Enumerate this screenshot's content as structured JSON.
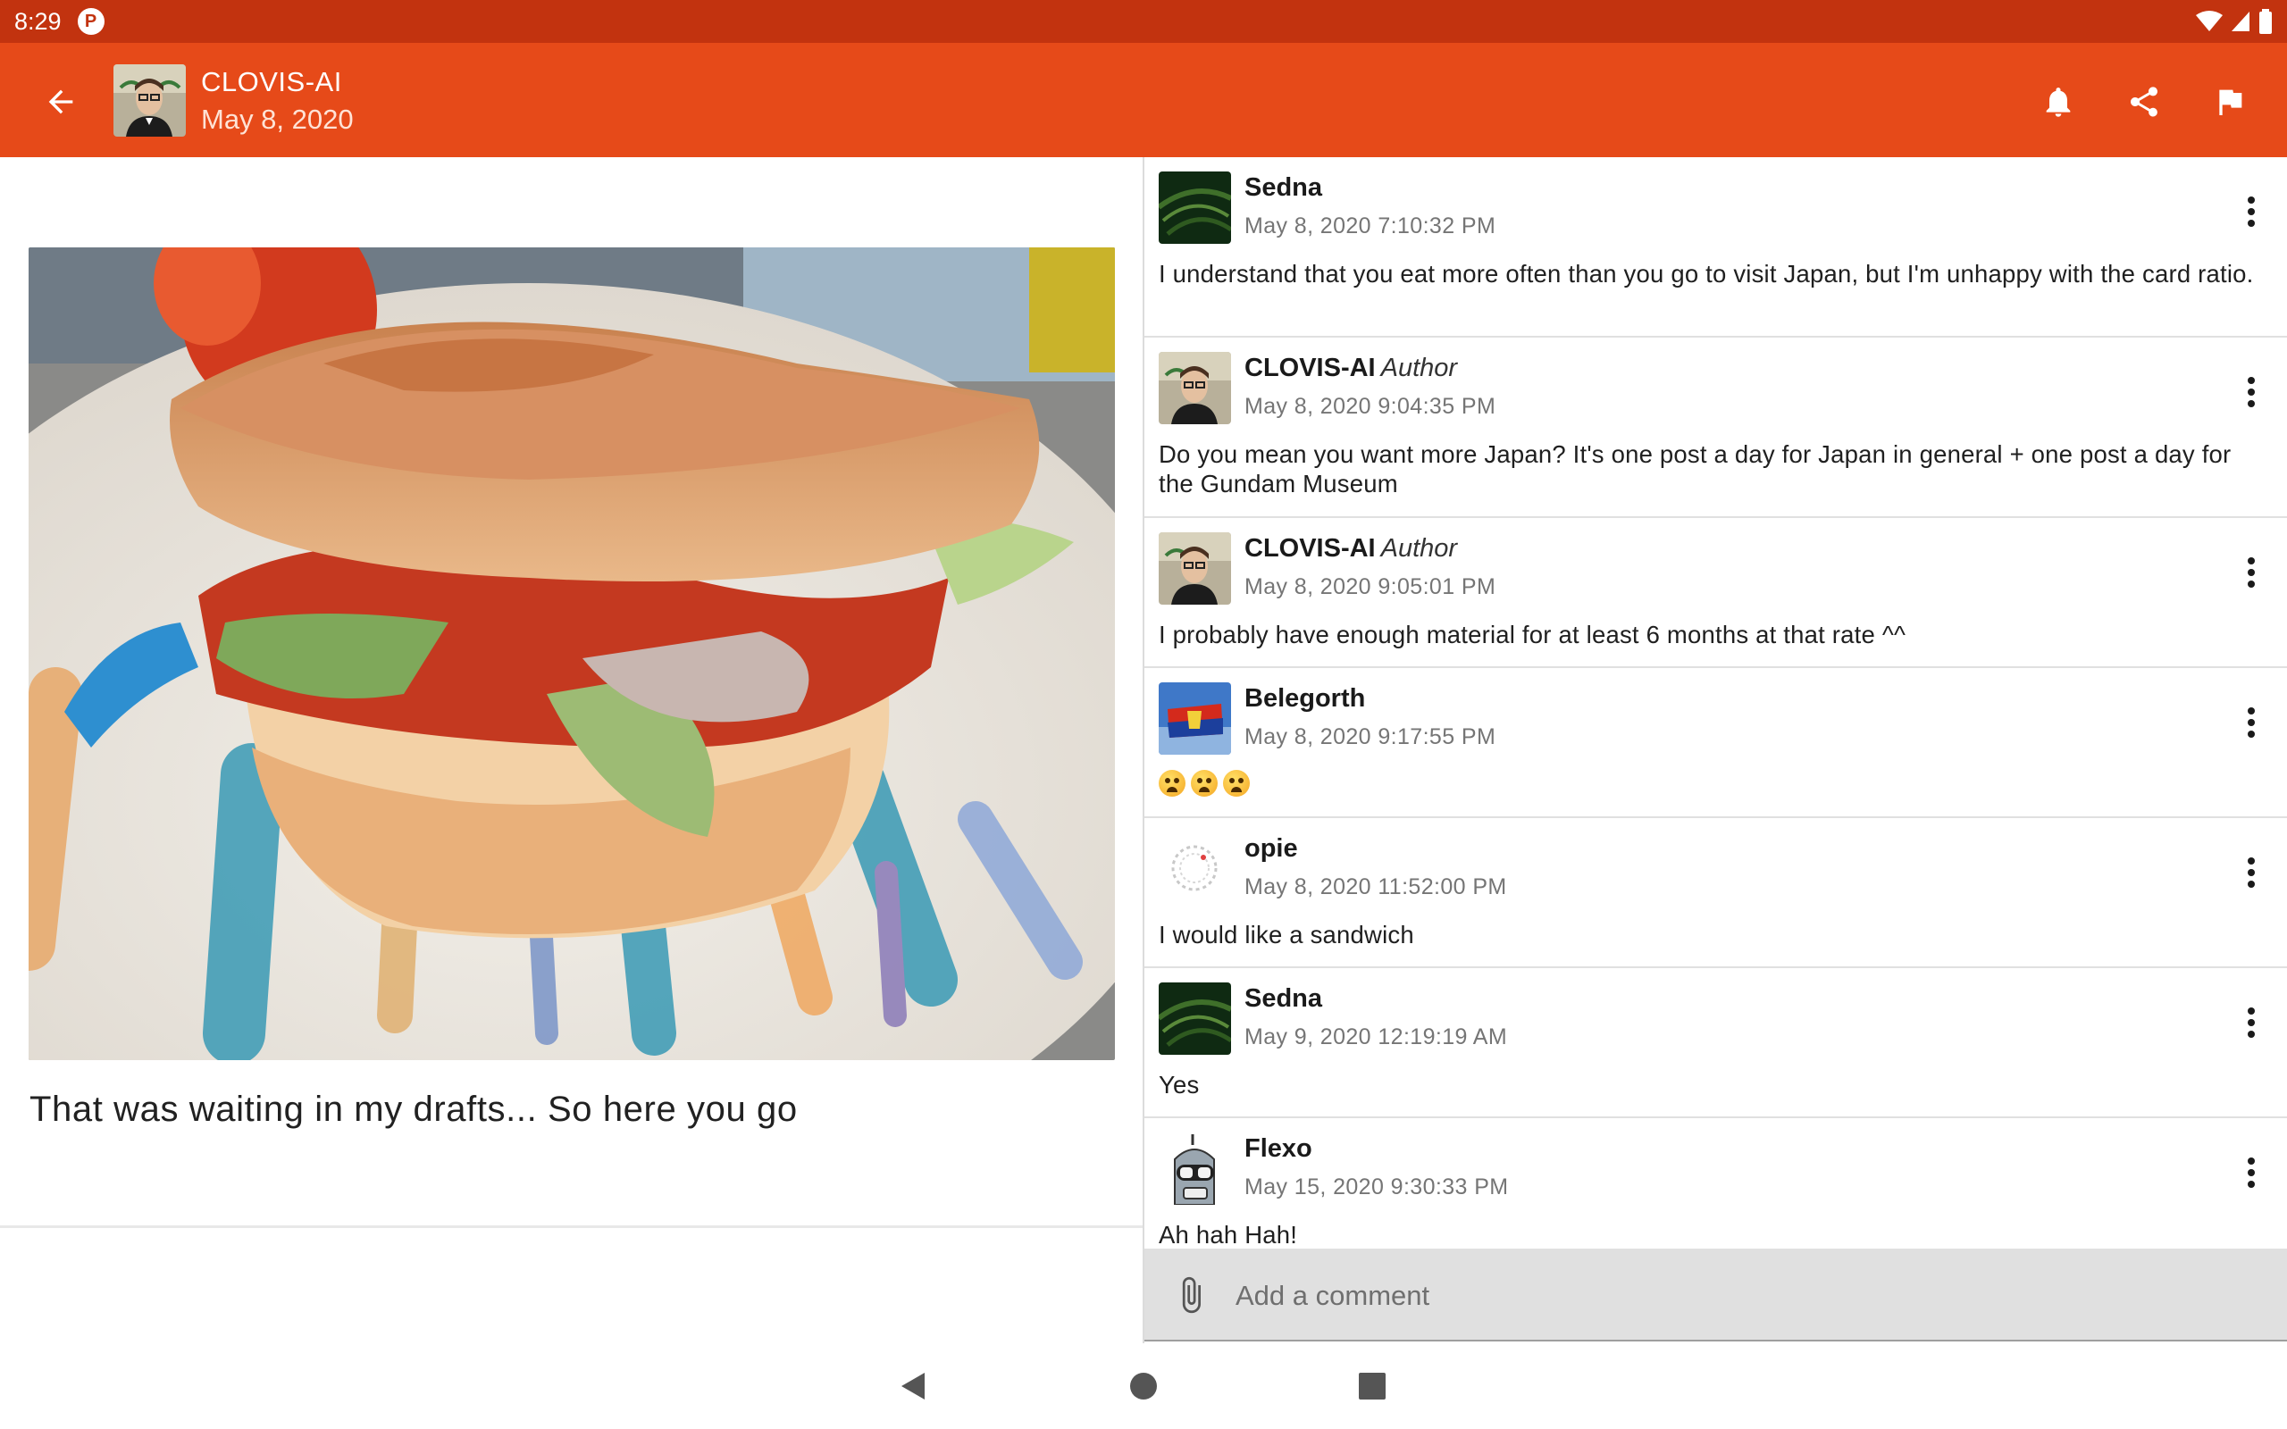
{
  "status_bar": {
    "time": "8:29",
    "app_icon": "P"
  },
  "header": {
    "title": "CLOVIS-AI",
    "subtitle": "May 8, 2020",
    "actions": [
      "bell-icon",
      "share-icon",
      "flag-icon"
    ]
  },
  "post": {
    "caption": "That was waiting in my drafts... So here you go"
  },
  "comments": [
    {
      "author": "Sedna",
      "badge": "",
      "date": "May 8, 2020 7:10:32 PM",
      "text": "I understand that you eat more often than you go to visit Japan, but I'm unhappy with the card ratio."
    },
    {
      "author": "CLOVIS-AI",
      "badge": "Author",
      "date": "May 8, 2020 9:04:35 PM",
      "text": "Do you mean you want more Japan? It's one post a day for Japan in general + one post a day for the Gundam Museum"
    },
    {
      "author": "CLOVIS-AI",
      "badge": "Author",
      "date": "May 8, 2020 9:05:01 PM",
      "text": "I probably have enough material for at least 6 months at that rate ^^"
    },
    {
      "author": "Belegorth",
      "badge": "",
      "date": "May 8, 2020 9:17:55 PM",
      "text": ""
    },
    {
      "author": "opie",
      "badge": "",
      "date": "May 8, 2020 11:52:00 PM",
      "text": "I would like a sandwich"
    },
    {
      "author": "Sedna",
      "badge": "",
      "date": "May 9, 2020 12:19:19 AM",
      "text": "Yes"
    },
    {
      "author": "Flexo",
      "badge": "",
      "date": "May 15, 2020 9:30:33 PM",
      "text": "Ah hah Hah!"
    }
  ],
  "comment_input": {
    "placeholder": "Add a comment"
  },
  "colors": {
    "app_bar": "#e64a19",
    "status_bar": "#c2330f",
    "input_bg": "#e0e0e0"
  }
}
